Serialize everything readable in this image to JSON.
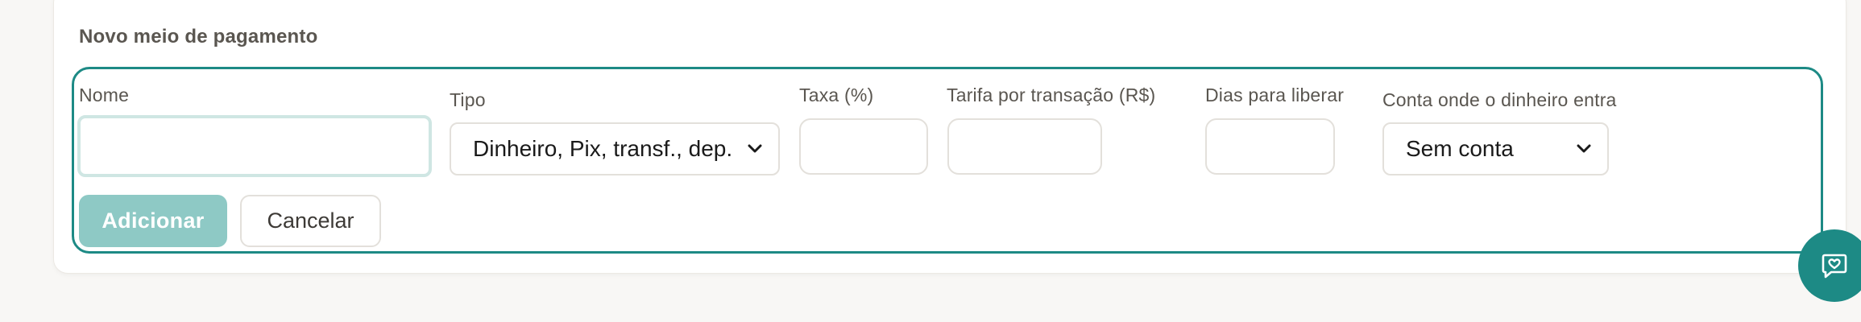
{
  "form": {
    "title": "Novo meio de pagamento",
    "fields": {
      "nome": {
        "label": "Nome",
        "value": ""
      },
      "tipo": {
        "label": "Tipo",
        "selected": "Dinheiro, Pix, transf., dep."
      },
      "taxa": {
        "label": "Taxa (%)",
        "value": ""
      },
      "tarifa": {
        "label": "Tarifa por transação (R$)",
        "value": ""
      },
      "dias": {
        "label": "Dias para liberar",
        "value": ""
      },
      "conta": {
        "label": "Conta onde o dinheiro entra",
        "selected": "Sem conta"
      }
    },
    "buttons": {
      "add_label": "Adicionar",
      "cancel_label": "Cancelar"
    }
  },
  "icons": {
    "select_chevron": "chevron-down-icon",
    "chat": "chat-heart-icon"
  },
  "colors": {
    "accent": "#1d8a85",
    "primary_button_disabled": "#8ec9c5",
    "focus_ring": "#cfe6e3"
  }
}
